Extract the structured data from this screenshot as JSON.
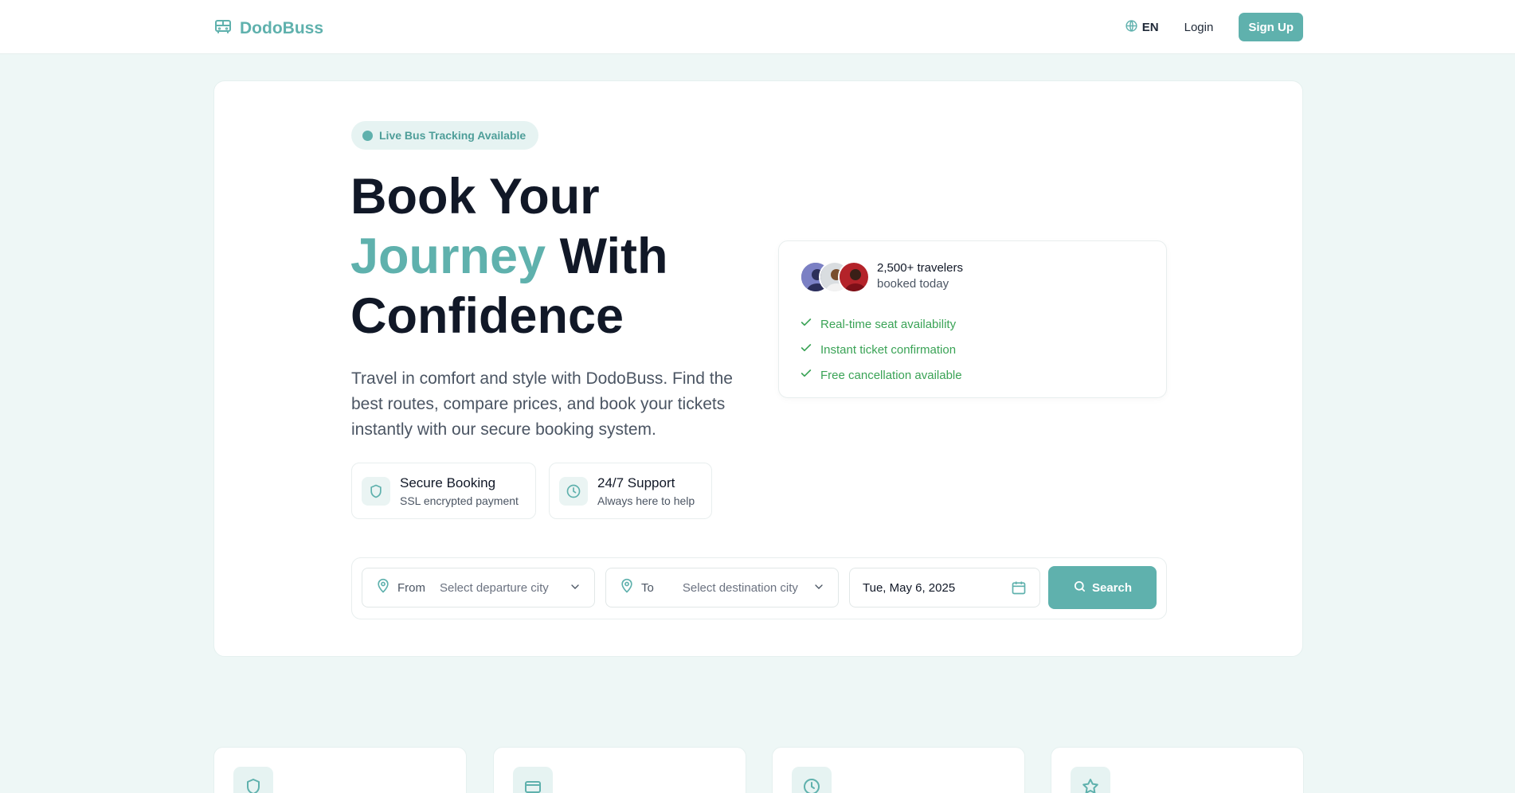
{
  "colors": {
    "accent": "#5fb1ad",
    "success": "#3aa356",
    "text": "#111827",
    "muted": "#4b5563"
  },
  "nav": {
    "brand": "DodoBuss",
    "brand_icon": "bus-icon",
    "language": "EN",
    "language_icon": "globe-icon",
    "login": "Login",
    "signup": "Sign Up"
  },
  "hero": {
    "badge": "Live Bus Tracking Available",
    "headline": {
      "line1": "Book Your",
      "accent": "Journey",
      "rest": " With",
      "line3": "Confidence"
    },
    "lead": "Travel in comfort and style with DodoBuss. Find the best routes, compare prices, and book your tickets instantly with our secure booking system.",
    "features": [
      {
        "icon": "shield-icon",
        "title": "Secure Booking",
        "subtitle": "SSL encrypted payment"
      },
      {
        "icon": "clock-icon",
        "title": "24/7 Support",
        "subtitle": "Always here to help"
      }
    ]
  },
  "social_proof": {
    "count": "2,500+ travelers",
    "subtitle": "booked today",
    "checks": [
      "Real-time seat availability",
      "Instant ticket confirmation",
      "Free cancellation available"
    ]
  },
  "search": {
    "from_label": "From",
    "from_placeholder": "Select departure city",
    "to_label": "To",
    "to_placeholder": "Select destination city",
    "date": "Tue, May 6, 2025",
    "button": "Search"
  },
  "cards": [
    {
      "icon": "shield-icon"
    },
    {
      "icon": "credit-card-icon"
    },
    {
      "icon": "clock-icon"
    },
    {
      "icon": "star-icon"
    }
  ]
}
